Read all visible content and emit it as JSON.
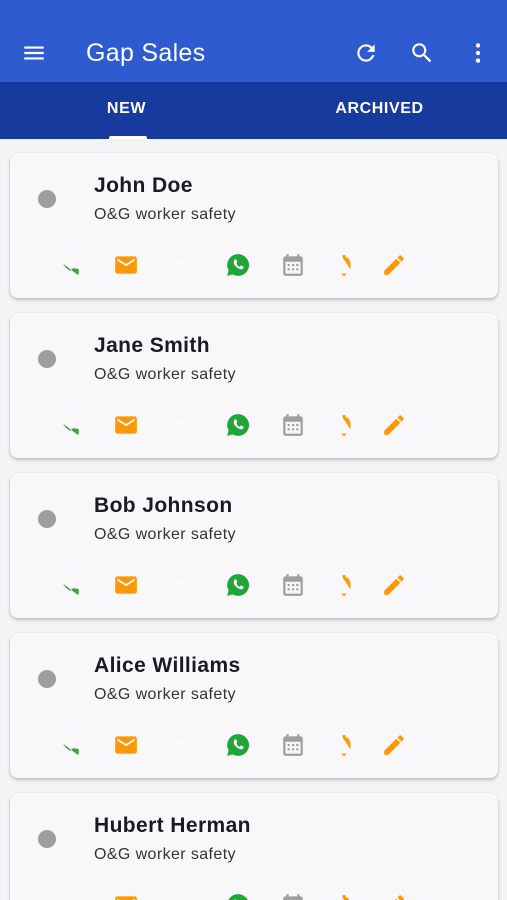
{
  "app_bar": {
    "title": "Gap Sales",
    "color": "#2f5bd0",
    "icons": [
      "menu-icon",
      "refresh-icon",
      "search-icon",
      "more-vert-icon"
    ]
  },
  "tabs": [
    {
      "label": "NEW",
      "selected": true
    },
    {
      "label": "ARCHIVED",
      "selected": false
    }
  ],
  "tab_bar_color": "#163a9e",
  "contact_actions": [
    "phone-icon",
    "email-icon",
    "message-icon",
    "whatsapp-icon",
    "calendar-icon",
    "bell-icon",
    "edit-icon",
    "view-icon"
  ],
  "action_colors": {
    "phone": "#43a047",
    "email": "#ff9800",
    "message": "#9e9e9e",
    "whatsapp": "#1fa538",
    "calendar": "#9e9e9e",
    "bell": "#ff9800",
    "edit": "#ff9800",
    "view": "#9e9e9e"
  },
  "contacts": [
    {
      "name": "John Doe",
      "subtitle": "O&G worker safety",
      "status_color": "#9e9e9e"
    },
    {
      "name": "Jane Smith",
      "subtitle": "O&G worker safety",
      "status_color": "#9e9e9e"
    },
    {
      "name": "Bob Johnson",
      "subtitle": "O&G worker safety",
      "status_color": "#9e9e9e"
    },
    {
      "name": "Alice Williams",
      "subtitle": "O&G worker safety",
      "status_color": "#9e9e9e"
    },
    {
      "name": "Hubert Herman",
      "subtitle": "O&G worker safety",
      "status_color": "#9e9e9e"
    }
  ]
}
